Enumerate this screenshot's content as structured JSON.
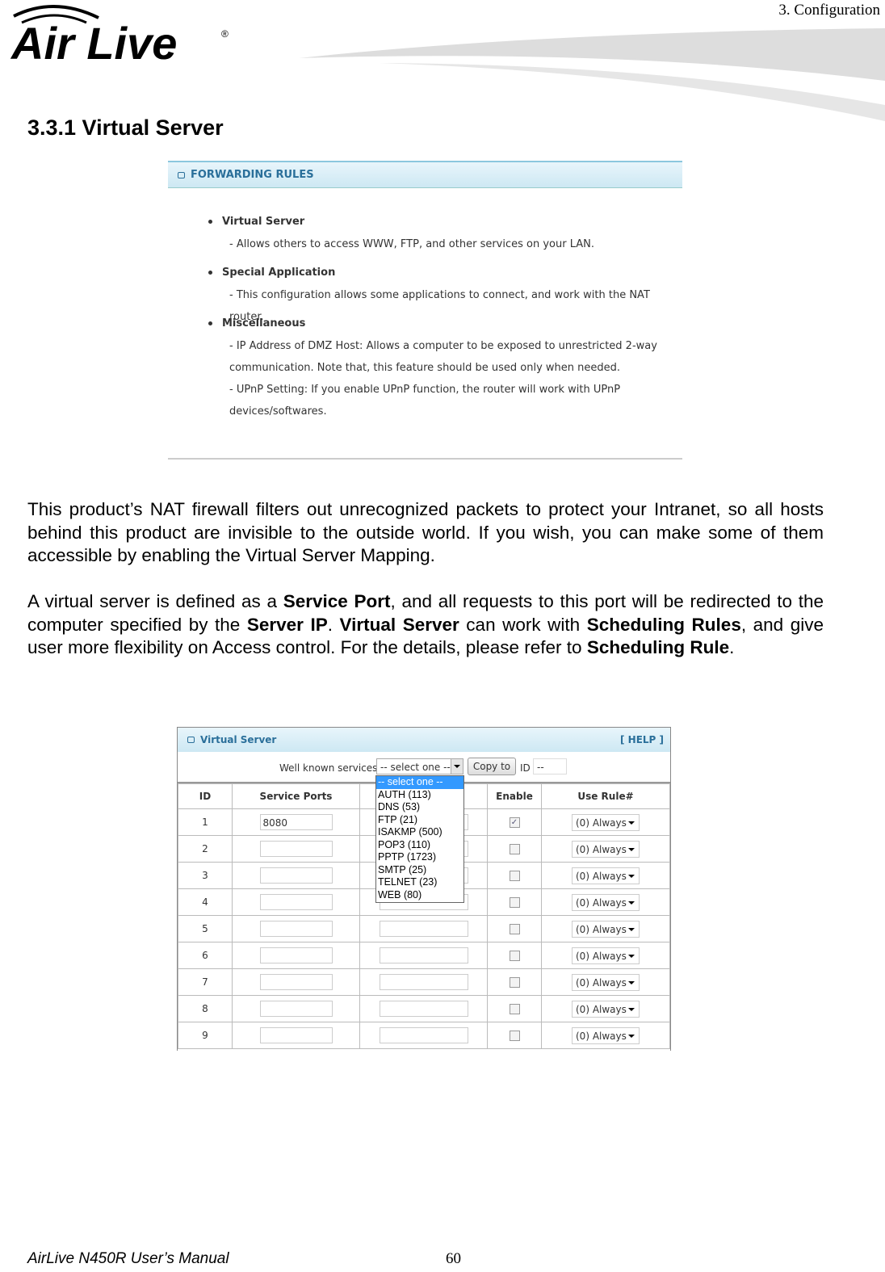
{
  "header": {
    "chapter": "3.  Configuration",
    "logo_text": "Air Live"
  },
  "section_title": "3.3.1 Virtual Server",
  "forwarding_rules": {
    "title": "FORWARDING RULES",
    "items": [
      {
        "label": "Virtual Server",
        "desc": [
          "- Allows others to access WWW, FTP, and other services on your LAN."
        ]
      },
      {
        "label": "Special Application",
        "desc": [
          "- This configuration allows some applications to connect, and work with the NAT router."
        ]
      },
      {
        "label": "Miscellaneous",
        "desc": [
          "- IP Address of DMZ Host: Allows a computer to be exposed to unrestricted 2-way",
          "communication. Note that, this feature should be used only when needed.",
          "- UPnP Setting: If you enable UPnP function, the router will work with UPnP",
          "devices/softwares."
        ]
      }
    ]
  },
  "para1": "This product’s NAT firewall filters out unrecognized packets to protect your Intranet, so all hosts behind this product are invisible to the outside world. If you wish, you can make some of them accessible by enabling the Virtual Server Mapping.",
  "para2": {
    "t1": "A virtual server is defined as a ",
    "b1": "Service Port",
    "t2": ", and all requests to this port will be redirected to the computer specified by the ",
    "b2": "Server IP",
    "t3": ". ",
    "b3": "Virtual Server",
    "t4": " can work with ",
    "b4": "Scheduling Rules",
    "t5": ", and give user more flexibility on Access control. For the details, please refer to ",
    "b5": "Scheduling Rule",
    "t6": "."
  },
  "virtual_server": {
    "title": "Virtual Server",
    "help": "[ HELP ]",
    "well_known_label": "Well known services",
    "selected_service": "-- select one --",
    "copy_button": "Copy to",
    "id_label": "ID",
    "id_value": "--",
    "dropdown_options": [
      "-- select one --",
      "AUTH (113)",
      "DNS (53)",
      "FTP (21)",
      "ISAKMP (500)",
      "POP3 (110)",
      "PPTP (1723)",
      "SMTP (25)",
      "TELNET (23)",
      "WEB (80)"
    ],
    "columns": [
      "ID",
      "Service Ports",
      "",
      "Enable",
      "Use Rule#"
    ],
    "rows": [
      {
        "id": "1",
        "port": "8080",
        "enabled": true,
        "rule": "(0) Always"
      },
      {
        "id": "2",
        "port": "",
        "enabled": false,
        "rule": "(0) Always"
      },
      {
        "id": "3",
        "port": "",
        "enabled": false,
        "rule": "(0) Always"
      },
      {
        "id": "4",
        "port": "",
        "enabled": false,
        "rule": "(0) Always"
      },
      {
        "id": "5",
        "port": "",
        "enabled": false,
        "rule": "(0) Always"
      },
      {
        "id": "6",
        "port": "",
        "enabled": false,
        "rule": "(0) Always"
      },
      {
        "id": "7",
        "port": "",
        "enabled": false,
        "rule": "(0) Always"
      },
      {
        "id": "8",
        "port": "",
        "enabled": false,
        "rule": "(0) Always"
      },
      {
        "id": "9",
        "port": "",
        "enabled": false,
        "rule": "(0) Always"
      }
    ]
  },
  "footer": {
    "manual": "AirLive N450R User’s Manual",
    "page": "60"
  }
}
